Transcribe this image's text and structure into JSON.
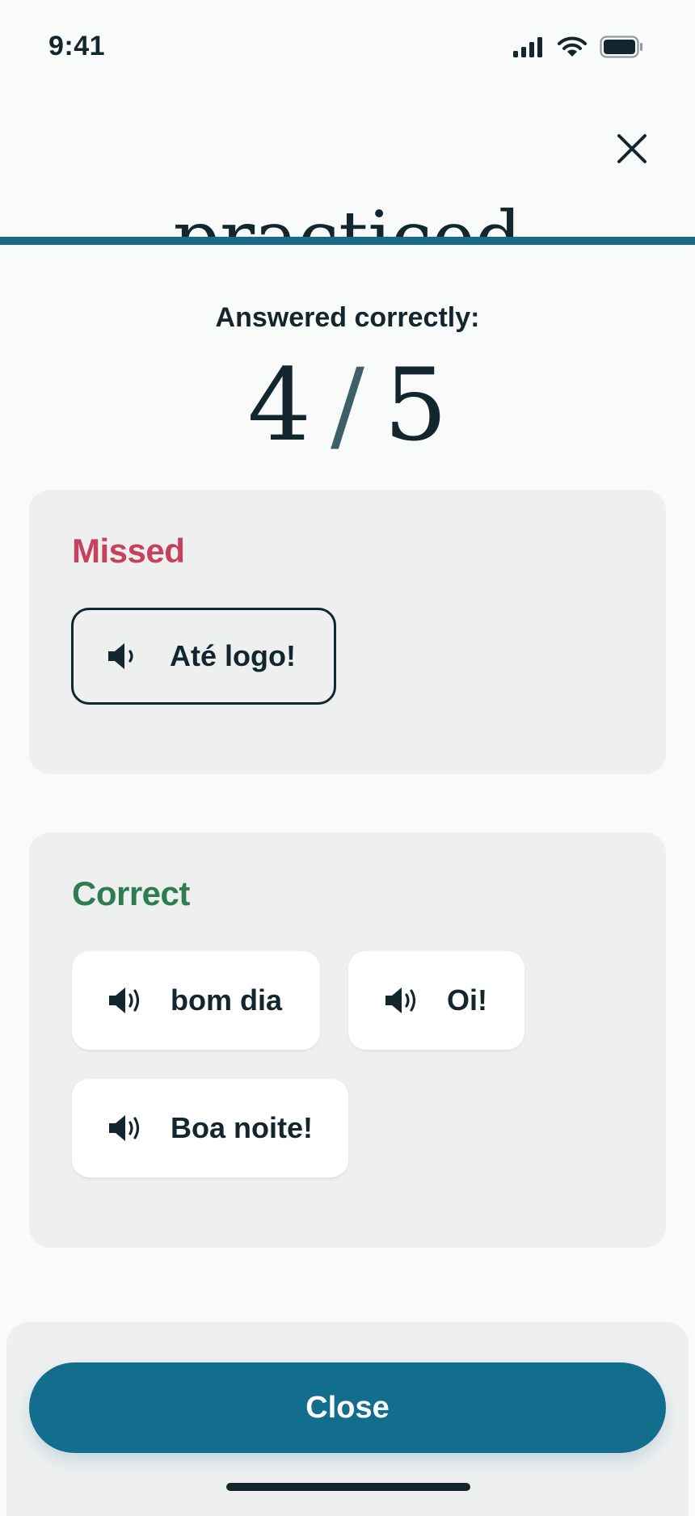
{
  "status_bar": {
    "time": "9:41",
    "icons": [
      "cellular-signal-icon",
      "wifi-icon",
      "battery-icon"
    ]
  },
  "header": {
    "close_icon": "close-icon",
    "title_partial": "practiced"
  },
  "summary": {
    "label": "Answered correctly:",
    "correct": "4",
    "separator": "/",
    "total": "5"
  },
  "missed": {
    "title": "Missed",
    "items": [
      {
        "label": "Até logo!",
        "icon": "speaker-icon"
      }
    ]
  },
  "correct": {
    "title": "Correct",
    "items": [
      {
        "label": "bom dia",
        "icon": "speaker-icon"
      },
      {
        "label": "Oi!",
        "icon": "speaker-icon"
      },
      {
        "label": "Boa noite!",
        "icon": "speaker-icon"
      }
    ]
  },
  "footer": {
    "close_label": "Close"
  },
  "colors": {
    "accent": "#136d8d",
    "missed": "#c7405d",
    "correct": "#2e7d52",
    "text": "#13262e",
    "card_bg": "#eef0f0"
  }
}
